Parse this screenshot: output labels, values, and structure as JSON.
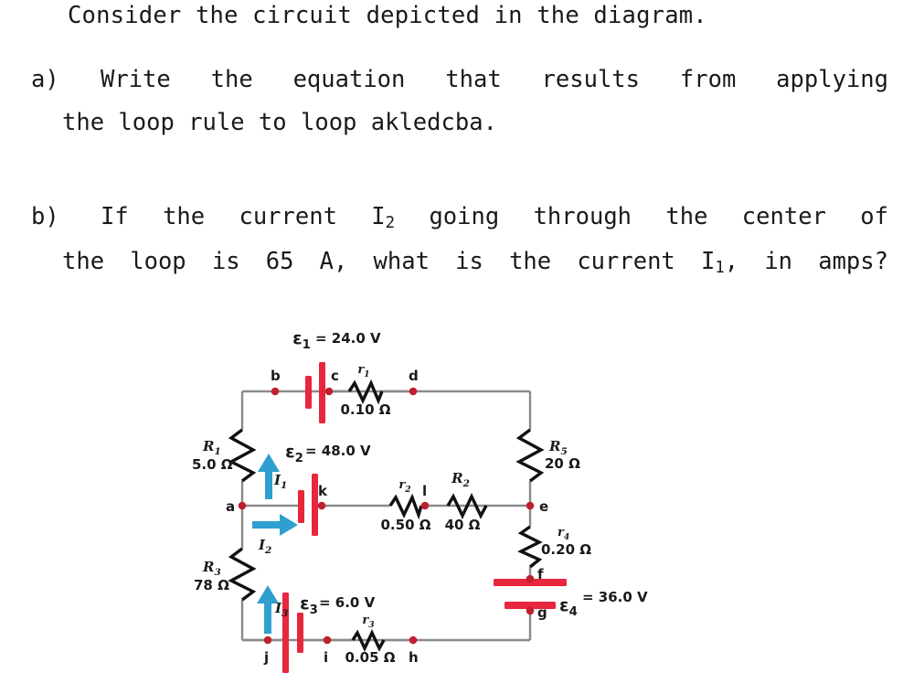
{
  "problem": {
    "stem": "Consider the circuit depicted in the diagram.",
    "part_a": {
      "label": "a)",
      "line1": "Write the equation that results from applying",
      "line2": "the loop rule to loop akledcba."
    },
    "part_b": {
      "label": "b)",
      "line1_pre": "If the current I",
      "line1_sub": "2",
      "line1_post": " going through the center of",
      "line2_pre": "the loop is 65 A, what is the current I",
      "line2_sub": "1",
      "line2_post": ", in amps?"
    }
  },
  "circuit": {
    "emfs": [
      {
        "id": "eps1",
        "symbol": "ε",
        "sub": "1",
        "eq": "= 24.0 V",
        "value": 24.0,
        "unit": "V"
      },
      {
        "id": "eps2",
        "symbol": "ε",
        "sub": "2",
        "eq": "= 48.0 V",
        "value": 48.0,
        "unit": "V"
      },
      {
        "id": "eps3",
        "symbol": "ε",
        "sub": "3",
        "eq": "= 6.0 V",
        "value": 6.0,
        "unit": "V"
      },
      {
        "id": "eps4",
        "symbol": "ε",
        "sub": "4",
        "eq": "= 36.0 V",
        "value": 36.0,
        "unit": "V"
      }
    ],
    "resistors": [
      {
        "id": "R1",
        "symbol": "R",
        "sub": "1",
        "value": "5.0 Ω"
      },
      {
        "id": "R3",
        "symbol": "R",
        "sub": "3",
        "value": "78 Ω"
      },
      {
        "id": "R5",
        "symbol": "R",
        "sub": "5",
        "value": "20 Ω"
      },
      {
        "id": "R2",
        "symbol": "R",
        "sub": "2",
        "value": "40 Ω"
      },
      {
        "id": "r1",
        "symbol": "r",
        "sub": "1",
        "value": "0.10 Ω"
      },
      {
        "id": "r2",
        "symbol": "r",
        "sub": "2",
        "value": "0.50 Ω"
      },
      {
        "id": "r3",
        "symbol": "r",
        "sub": "3",
        "value": "0.05 Ω"
      },
      {
        "id": "r4",
        "symbol": "r",
        "sub": "4",
        "value": "0.20 Ω"
      }
    ],
    "nodes": [
      {
        "id": "a",
        "label": "a"
      },
      {
        "id": "b",
        "label": "b"
      },
      {
        "id": "c",
        "label": "c"
      },
      {
        "id": "d",
        "label": "d"
      },
      {
        "id": "e",
        "label": "e"
      },
      {
        "id": "f",
        "label": "f"
      },
      {
        "id": "g",
        "label": "g"
      },
      {
        "id": "h",
        "label": "h"
      },
      {
        "id": "i",
        "label": "i"
      },
      {
        "id": "j",
        "label": "j"
      },
      {
        "id": "k",
        "label": "k"
      },
      {
        "id": "l",
        "label": "l"
      }
    ],
    "currents": [
      {
        "id": "I1",
        "symbol": "I",
        "sub": "1",
        "direction": "up"
      },
      {
        "id": "I2",
        "symbol": "I",
        "sub": "2",
        "direction": "right"
      },
      {
        "id": "I3",
        "symbol": "I",
        "sub": "3",
        "direction": "up"
      }
    ],
    "colors": {
      "wire": "#8a8a8a",
      "resistor": "#111111",
      "node": "#c0202e",
      "battery": "#e8263c",
      "current_arrow": "#2f9fd0"
    }
  }
}
